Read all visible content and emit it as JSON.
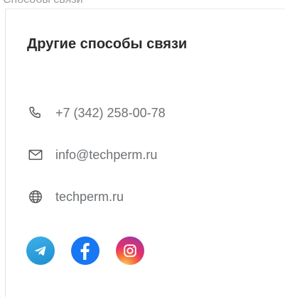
{
  "header_strip": {
    "partial_text": "Способы связи"
  },
  "contacts": {
    "title": "Другие способы связи",
    "phone": {
      "icon": "phone-icon",
      "value": "+7 (342) 258-00-78"
    },
    "email": {
      "icon": "mail-icon",
      "value": "info@techperm.ru"
    },
    "website": {
      "icon": "globe-icon",
      "value": "techperm.ru"
    }
  },
  "socials": [
    {
      "name": "telegram",
      "icon": "telegram-icon",
      "color": "#2AA3DF"
    },
    {
      "name": "facebook",
      "icon": "facebook-icon",
      "color": "#1877F2"
    },
    {
      "name": "instagram",
      "icon": "instagram-icon",
      "color": "#E1306C"
    }
  ],
  "colors": {
    "title": "#2B2B2B",
    "text": "#6E7276",
    "icon": "#555555",
    "border": "#E3E3E3"
  }
}
